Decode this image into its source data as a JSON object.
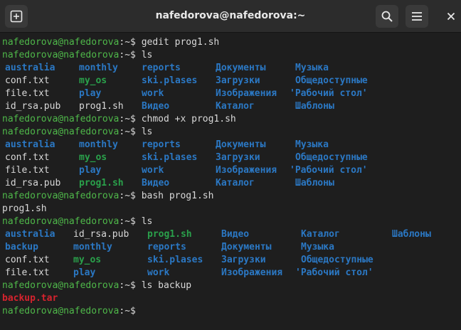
{
  "window": {
    "title": "nafedorova@nafedorova:~"
  },
  "icons": {
    "new_tab": "new-tab-icon",
    "search": "search-icon",
    "menu": "hamburger-menu-icon",
    "close": "close-icon"
  },
  "colors": {
    "prompt": "#4fb84a",
    "directory": "#2b78c4",
    "executable": "#2aa14b",
    "archive": "#d6232e",
    "text": "#d8d8d8",
    "background": "#1e1e1e"
  },
  "terminal": {
    "prompt_text": "nafedorova@nafedorova",
    "prompt_suffix": ":~$ ",
    "lines": [
      {
        "kind": "cmd",
        "text": "gedit prog1.sh"
      },
      {
        "kind": "cmd",
        "text": "ls"
      },
      {
        "kind": "ls",
        "cols": [
          7,
          111,
          199,
          303,
          415
        ],
        "cells": [
          {
            "t": "australia",
            "c": "dir"
          },
          {
            "t": "monthly",
            "c": "dir"
          },
          {
            "t": "reports",
            "c": "dir"
          },
          {
            "t": "Документы",
            "c": "dir"
          },
          {
            "t": "Музыка",
            "c": "dir"
          }
        ]
      },
      {
        "kind": "ls",
        "cols": [
          7,
          111,
          199,
          303,
          415
        ],
        "cells": [
          {
            "t": "conf.txt",
            "c": "file"
          },
          {
            "t": "my_os",
            "c": "exec"
          },
          {
            "t": "ski.plases",
            "c": "dir"
          },
          {
            "t": "Загрузки",
            "c": "dir"
          },
          {
            "t": "Общедоступные",
            "c": "dir"
          }
        ]
      },
      {
        "kind": "ls",
        "cols": [
          7,
          111,
          199,
          303,
          407
        ],
        "cells": [
          {
            "t": "file.txt",
            "c": "file"
          },
          {
            "t": "play",
            "c": "dir"
          },
          {
            "t": "work",
            "c": "dir"
          },
          {
            "t": "Изображения",
            "c": "dir"
          },
          {
            "t": "'Рабочий стол'",
            "c": "dir"
          }
        ]
      },
      {
        "kind": "ls",
        "cols": [
          7,
          111,
          199,
          303,
          415
        ],
        "cells": [
          {
            "t": "id_rsa.pub",
            "c": "file"
          },
          {
            "t": "prog1.sh",
            "c": "file"
          },
          {
            "t": "Видео",
            "c": "dir"
          },
          {
            "t": "Каталог",
            "c": "dir"
          },
          {
            "t": "Шаблоны",
            "c": "dir"
          }
        ]
      },
      {
        "kind": "cmd",
        "text": "chmod +x prog1.sh"
      },
      {
        "kind": "cmd",
        "text": "ls"
      },
      {
        "kind": "ls",
        "cols": [
          7,
          111,
          199,
          303,
          415
        ],
        "cells": [
          {
            "t": "australia",
            "c": "dir"
          },
          {
            "t": "monthly",
            "c": "dir"
          },
          {
            "t": "reports",
            "c": "dir"
          },
          {
            "t": "Документы",
            "c": "dir"
          },
          {
            "t": "Музыка",
            "c": "dir"
          }
        ]
      },
      {
        "kind": "ls",
        "cols": [
          7,
          111,
          199,
          303,
          415
        ],
        "cells": [
          {
            "t": "conf.txt",
            "c": "file"
          },
          {
            "t": "my_os",
            "c": "exec"
          },
          {
            "t": "ski.plases",
            "c": "dir"
          },
          {
            "t": "Загрузки",
            "c": "dir"
          },
          {
            "t": "Общедоступные",
            "c": "dir"
          }
        ]
      },
      {
        "kind": "ls",
        "cols": [
          7,
          111,
          199,
          303,
          407
        ],
        "cells": [
          {
            "t": "file.txt",
            "c": "file"
          },
          {
            "t": "play",
            "c": "dir"
          },
          {
            "t": "work",
            "c": "dir"
          },
          {
            "t": "Изображения",
            "c": "dir"
          },
          {
            "t": "'Рабочий стол'",
            "c": "dir"
          }
        ]
      },
      {
        "kind": "ls",
        "cols": [
          7,
          111,
          199,
          303,
          415
        ],
        "cells": [
          {
            "t": "id_rsa.pub",
            "c": "file"
          },
          {
            "t": "prog1.sh",
            "c": "exec"
          },
          {
            "t": "Видео",
            "c": "dir"
          },
          {
            "t": "Каталог",
            "c": "dir"
          },
          {
            "t": "Шаблоны",
            "c": "dir"
          }
        ]
      },
      {
        "kind": "cmd",
        "text": "bash prog1.sh"
      },
      {
        "kind": "out",
        "text": "prog1.sh",
        "c": "plain"
      },
      {
        "kind": "cmd",
        "text": "ls"
      },
      {
        "kind": "ls",
        "cols": [
          7,
          103,
          207,
          311,
          423,
          551
        ],
        "cells": [
          {
            "t": "australia",
            "c": "dir"
          },
          {
            "t": "id_rsa.pub",
            "c": "file"
          },
          {
            "t": "prog1.sh",
            "c": "exec"
          },
          {
            "t": "Видео",
            "c": "dir"
          },
          {
            "t": "Каталог",
            "c": "dir"
          },
          {
            "t": "Шаблоны",
            "c": "dir"
          }
        ]
      },
      {
        "kind": "ls",
        "cols": [
          7,
          103,
          207,
          311,
          423
        ],
        "cells": [
          {
            "t": "backup",
            "c": "dir"
          },
          {
            "t": "monthly",
            "c": "dir"
          },
          {
            "t": "reports",
            "c": "dir"
          },
          {
            "t": "Документы",
            "c": "dir"
          },
          {
            "t": "Музыка",
            "c": "dir"
          }
        ]
      },
      {
        "kind": "ls",
        "cols": [
          7,
          103,
          207,
          311,
          423
        ],
        "cells": [
          {
            "t": "conf.txt",
            "c": "file"
          },
          {
            "t": "my_os",
            "c": "exec"
          },
          {
            "t": "ski.plases",
            "c": "dir"
          },
          {
            "t": "Загрузки",
            "c": "dir"
          },
          {
            "t": "Общедоступные",
            "c": "dir"
          }
        ]
      },
      {
        "kind": "ls",
        "cols": [
          7,
          103,
          207,
          311,
          415
        ],
        "cells": [
          {
            "t": "file.txt",
            "c": "file"
          },
          {
            "t": "play",
            "c": "dir"
          },
          {
            "t": "work",
            "c": "dir"
          },
          {
            "t": "Изображения",
            "c": "dir"
          },
          {
            "t": "'Рабочий стол'",
            "c": "dir"
          }
        ]
      },
      {
        "kind": "cmd",
        "text": "ls backup"
      },
      {
        "kind": "out",
        "text": "backup.tar",
        "c": "arch"
      },
      {
        "kind": "cmd",
        "text": ""
      }
    ]
  }
}
